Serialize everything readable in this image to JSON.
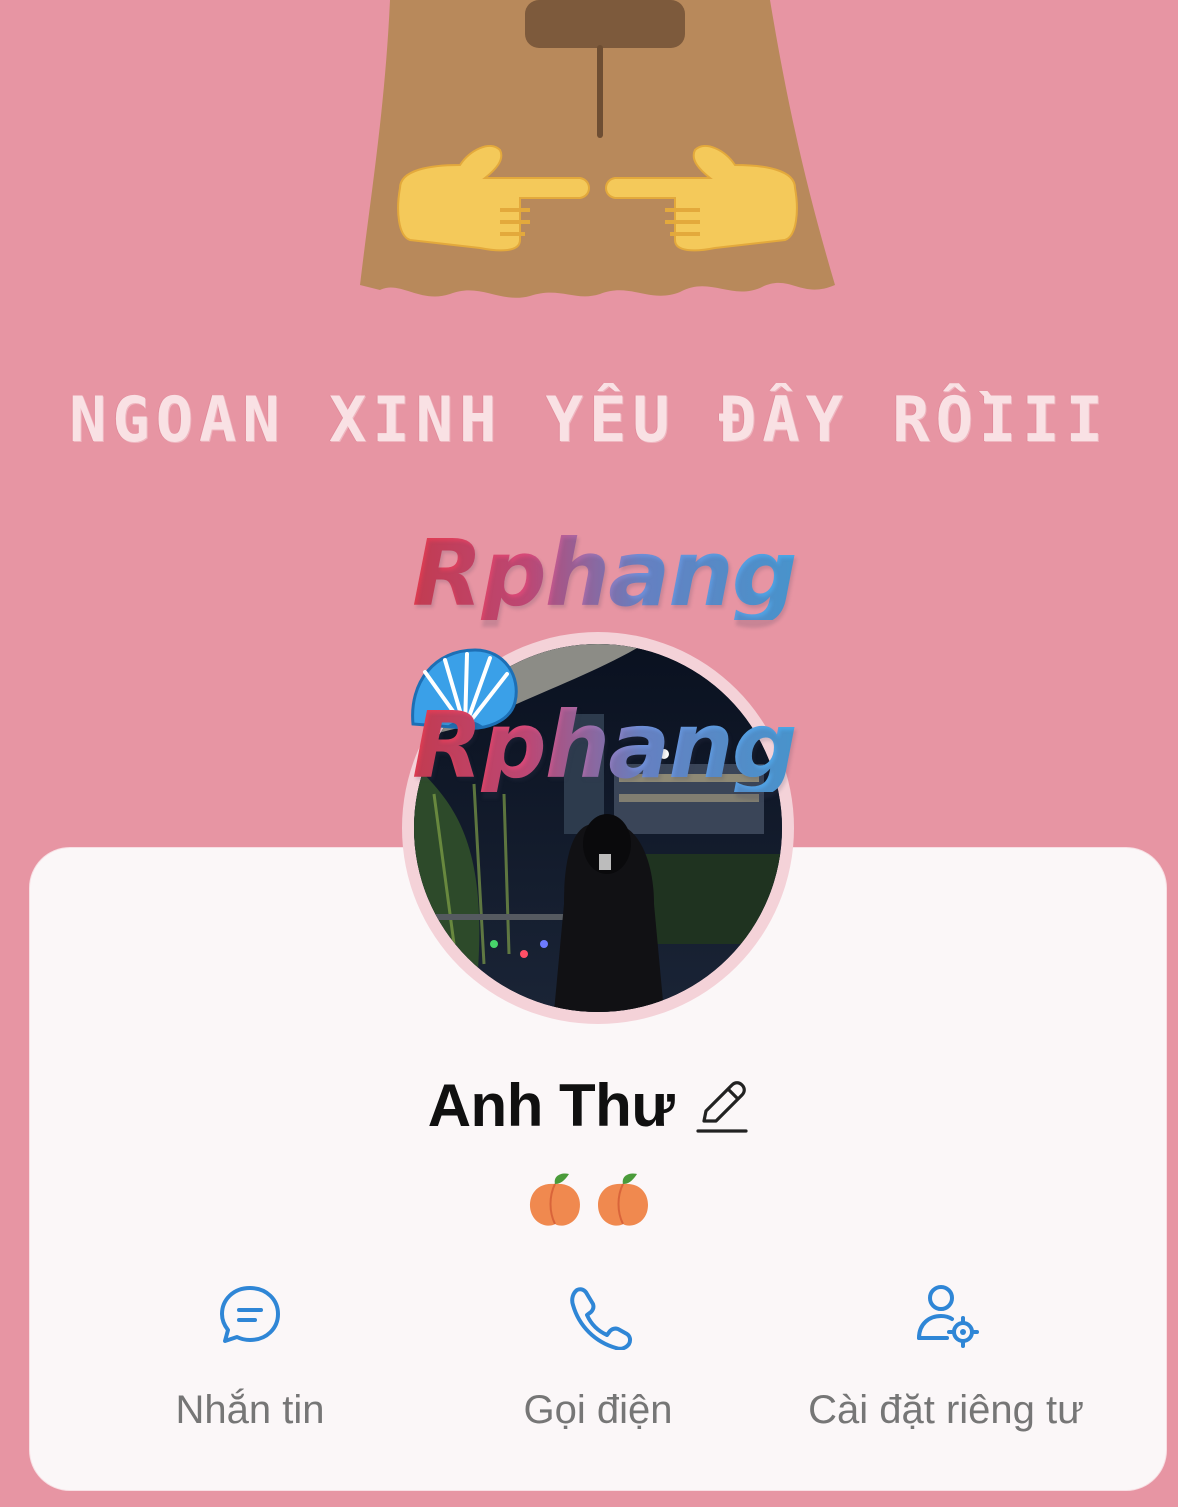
{
  "cover": {
    "caption": "NGOAN XINH YÊU ĐÂY RỒIII",
    "watermark_top": "Rphang",
    "watermark_bottom": "Rphang",
    "background_color": "#e795a3"
  },
  "profile": {
    "name": "Anh Thư",
    "bio": "🍑🍑",
    "edit_icon": "pencil-icon",
    "avatar_icon": "avatar-photo"
  },
  "actions": [
    {
      "label": "Nhắn tin",
      "icon": "chat-bubble-icon"
    },
    {
      "label": "Gọi điện",
      "icon": "phone-icon"
    },
    {
      "label": "Cài đặt riêng tư",
      "icon": "user-settings-icon"
    }
  ],
  "colors": {
    "accent": "#2f86d6",
    "label_gray": "#767676",
    "card": "#fbf7f8"
  }
}
